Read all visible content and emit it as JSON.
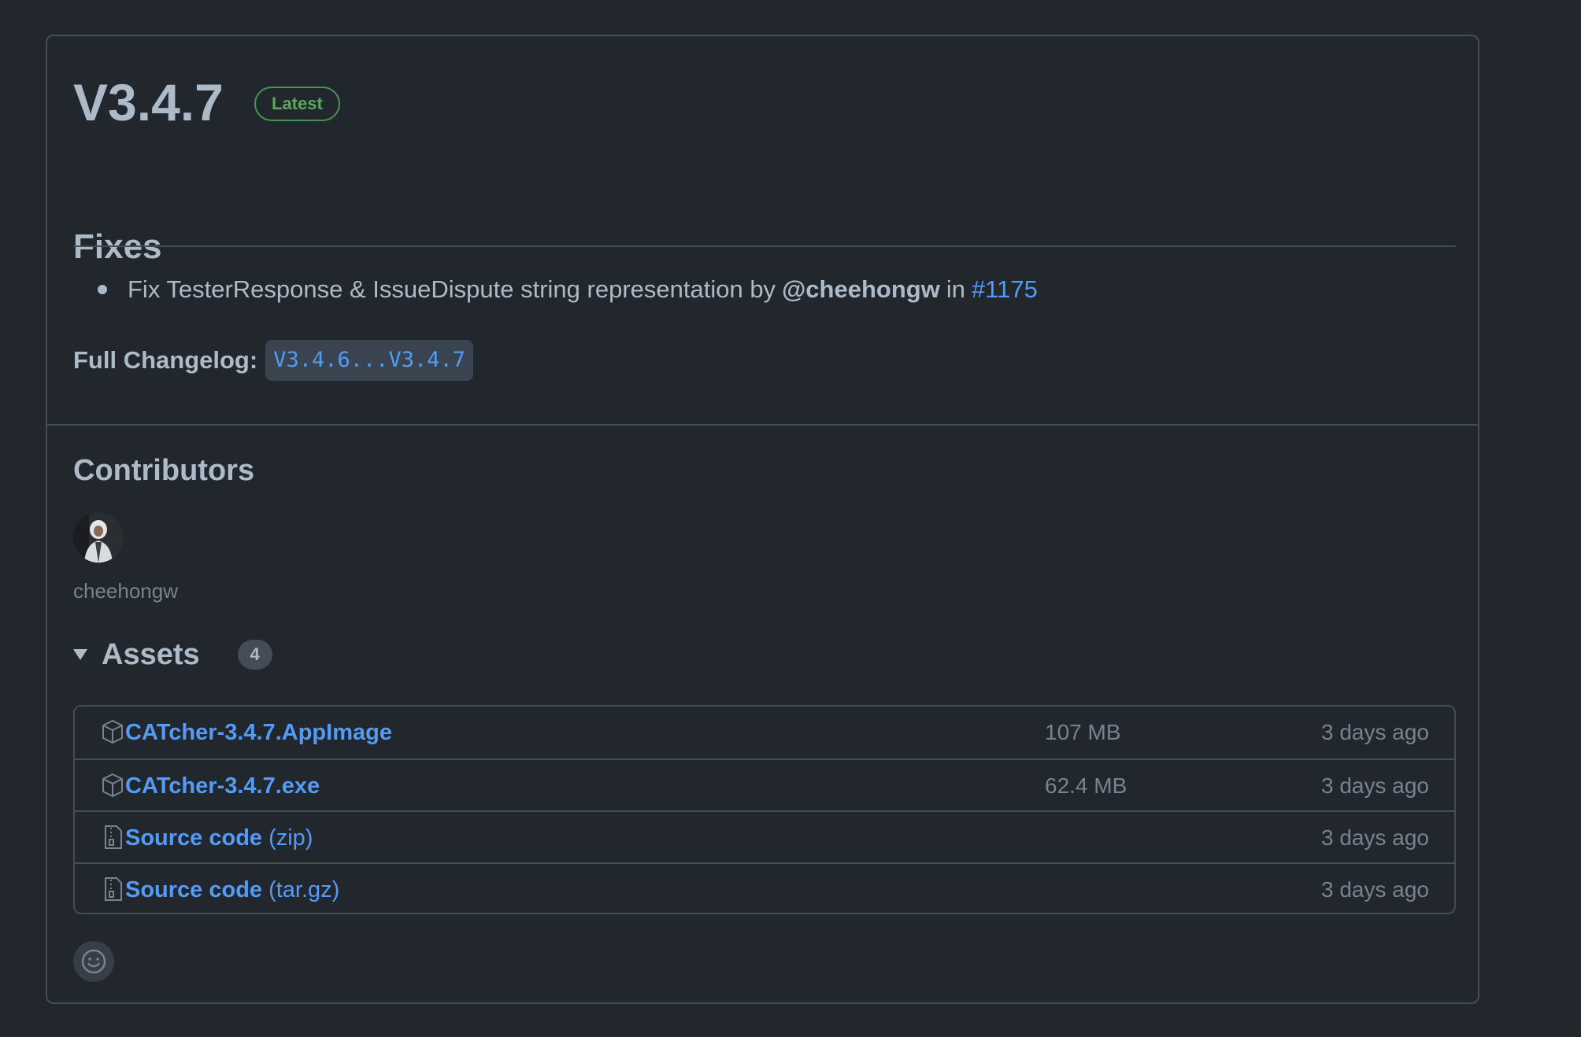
{
  "release": {
    "title": "V3.4.7",
    "badge": "Latest"
  },
  "notes": {
    "heading": "Fixes",
    "item": {
      "text": "Fix TesterResponse & IssueDispute string representation by",
      "mention": "@cheehongw",
      "in": "in",
      "pr": "#1175"
    },
    "changelog_label": "Full Changelog:",
    "changelog_link": "V3.4.6...V3.4.7"
  },
  "contributors": {
    "heading": "Contributors",
    "users": [
      "cheehongw"
    ]
  },
  "assets": {
    "heading": "Assets",
    "count": "4",
    "items": [
      {
        "name": "CATcher-3.4.7.AppImage",
        "suffix": "",
        "size": "107 MB",
        "date": "3 days ago",
        "icon": "package-icon"
      },
      {
        "name": "CATcher-3.4.7.exe",
        "suffix": "",
        "size": "62.4 MB",
        "date": "3 days ago",
        "icon": "package-icon"
      },
      {
        "name": "Source code",
        "suffix": "(zip)",
        "size": "",
        "date": "3 days ago",
        "icon": "file-zip-icon"
      },
      {
        "name": "Source code",
        "suffix": "(tar.gz)",
        "size": "",
        "date": "3 days ago",
        "icon": "file-zip-icon"
      }
    ]
  },
  "colors": {
    "background": "#22272e",
    "link": "#539bf5",
    "latest_badge": "#57ab5a",
    "border": "#444c56"
  },
  "icons": {
    "reaction": "smiley-icon",
    "collapse": "triangle-down-icon"
  }
}
